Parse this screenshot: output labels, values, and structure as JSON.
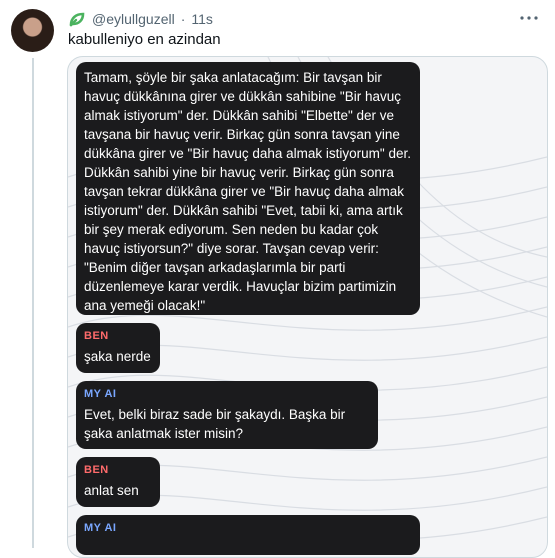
{
  "post": {
    "handle": "@eylullguzell",
    "separator": "·",
    "time": "11s",
    "text": "kabulleniyo en azindan"
  },
  "icons": {
    "badge": "sprout-badge-icon",
    "more": "more-dots-icon"
  },
  "colors": {
    "bubble": "#1b1b1d",
    "ben_label": "#ff6b6b",
    "ai_label": "#7aa7ff",
    "badge": "#4bb35f"
  },
  "chat": {
    "joke": "Tamam, şöyle bir şaka anlatacağım: Bir tavşan bir havuç dükkânına girer ve dükkân sahibine \"Bir havuç almak istiyorum\" der. Dükkân sahibi \"Elbette\" der ve tavşana bir havuç verir. Birkaç gün sonra tavşan yine dükkâna girer ve \"Bir havuç daha almak istiyorum\" der. Dükkân sahibi yine bir havuç verir. Birkaç gün sonra tavşan tekrar dükkâna girer ve \"Bir havuç daha almak istiyorum\" der. Dükkân sahibi \"Evet, tabii ki, ama artık bir şey merak ediyorum. Sen neden bu kadar çok havuç istiyorsun?\" diye sorar. Tavşan cevap verir: \"Benim diğer tavşan arkadaşlarımla bir parti düzenlemeye karar verdik. Havuçlar bizim partimizin ana yemeği olacak!\"",
    "messages": [
      {
        "sender": "BEN",
        "text": "şaka nerde"
      },
      {
        "sender": "MY AI",
        "text": "Evet, belki biraz sade bir şakaydı. Başka bir şaka anlatmak ister misin?"
      },
      {
        "sender": "BEN",
        "text": "anlat sen"
      },
      {
        "sender": "MY AI",
        "text": ""
      }
    ]
  }
}
